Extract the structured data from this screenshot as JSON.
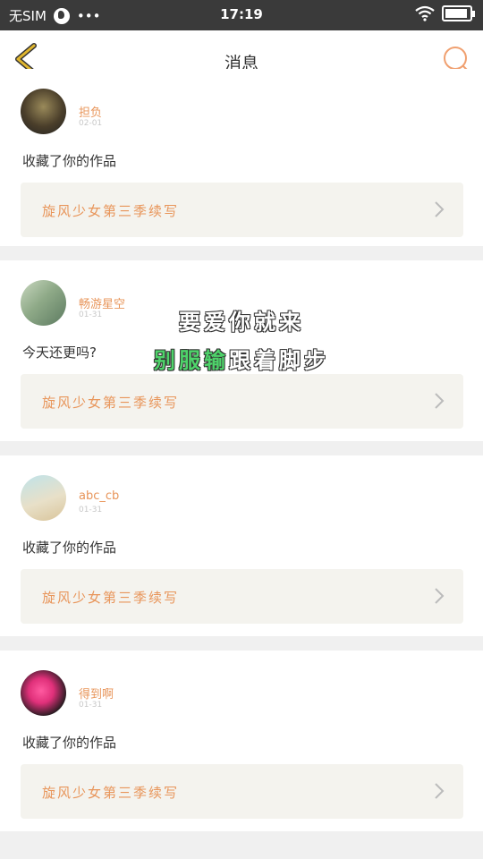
{
  "statusbar": {
    "carrier": "无SIM",
    "dots": "•••",
    "time": "17:19"
  },
  "header": {
    "title": "消息"
  },
  "messages": [
    {
      "user": "担负",
      "date": "02-01",
      "text": "收藏了你的作品",
      "quote": "旋风少女第三季续写"
    },
    {
      "user": "畅游星空",
      "date": "01-31",
      "text": "今天还更吗?",
      "quote": "旋风少女第三季续写"
    },
    {
      "user": "abc_cb",
      "date": "01-31",
      "text": "收藏了你的作品",
      "quote": "旋风少女第三季续写"
    },
    {
      "user": "得到啊",
      "date": "01-31",
      "text": "收藏了你的作品",
      "quote": "旋风少女第三季续写"
    }
  ],
  "overlay": {
    "line1": "要爱你就来",
    "line2_green": "别服输",
    "line2_white": "跟着脚步"
  },
  "colors": {
    "accent": "#e8955a",
    "back_arrow": "#e0b62f",
    "search": "#f0a070",
    "quote_bg": "#f4f3ee"
  }
}
